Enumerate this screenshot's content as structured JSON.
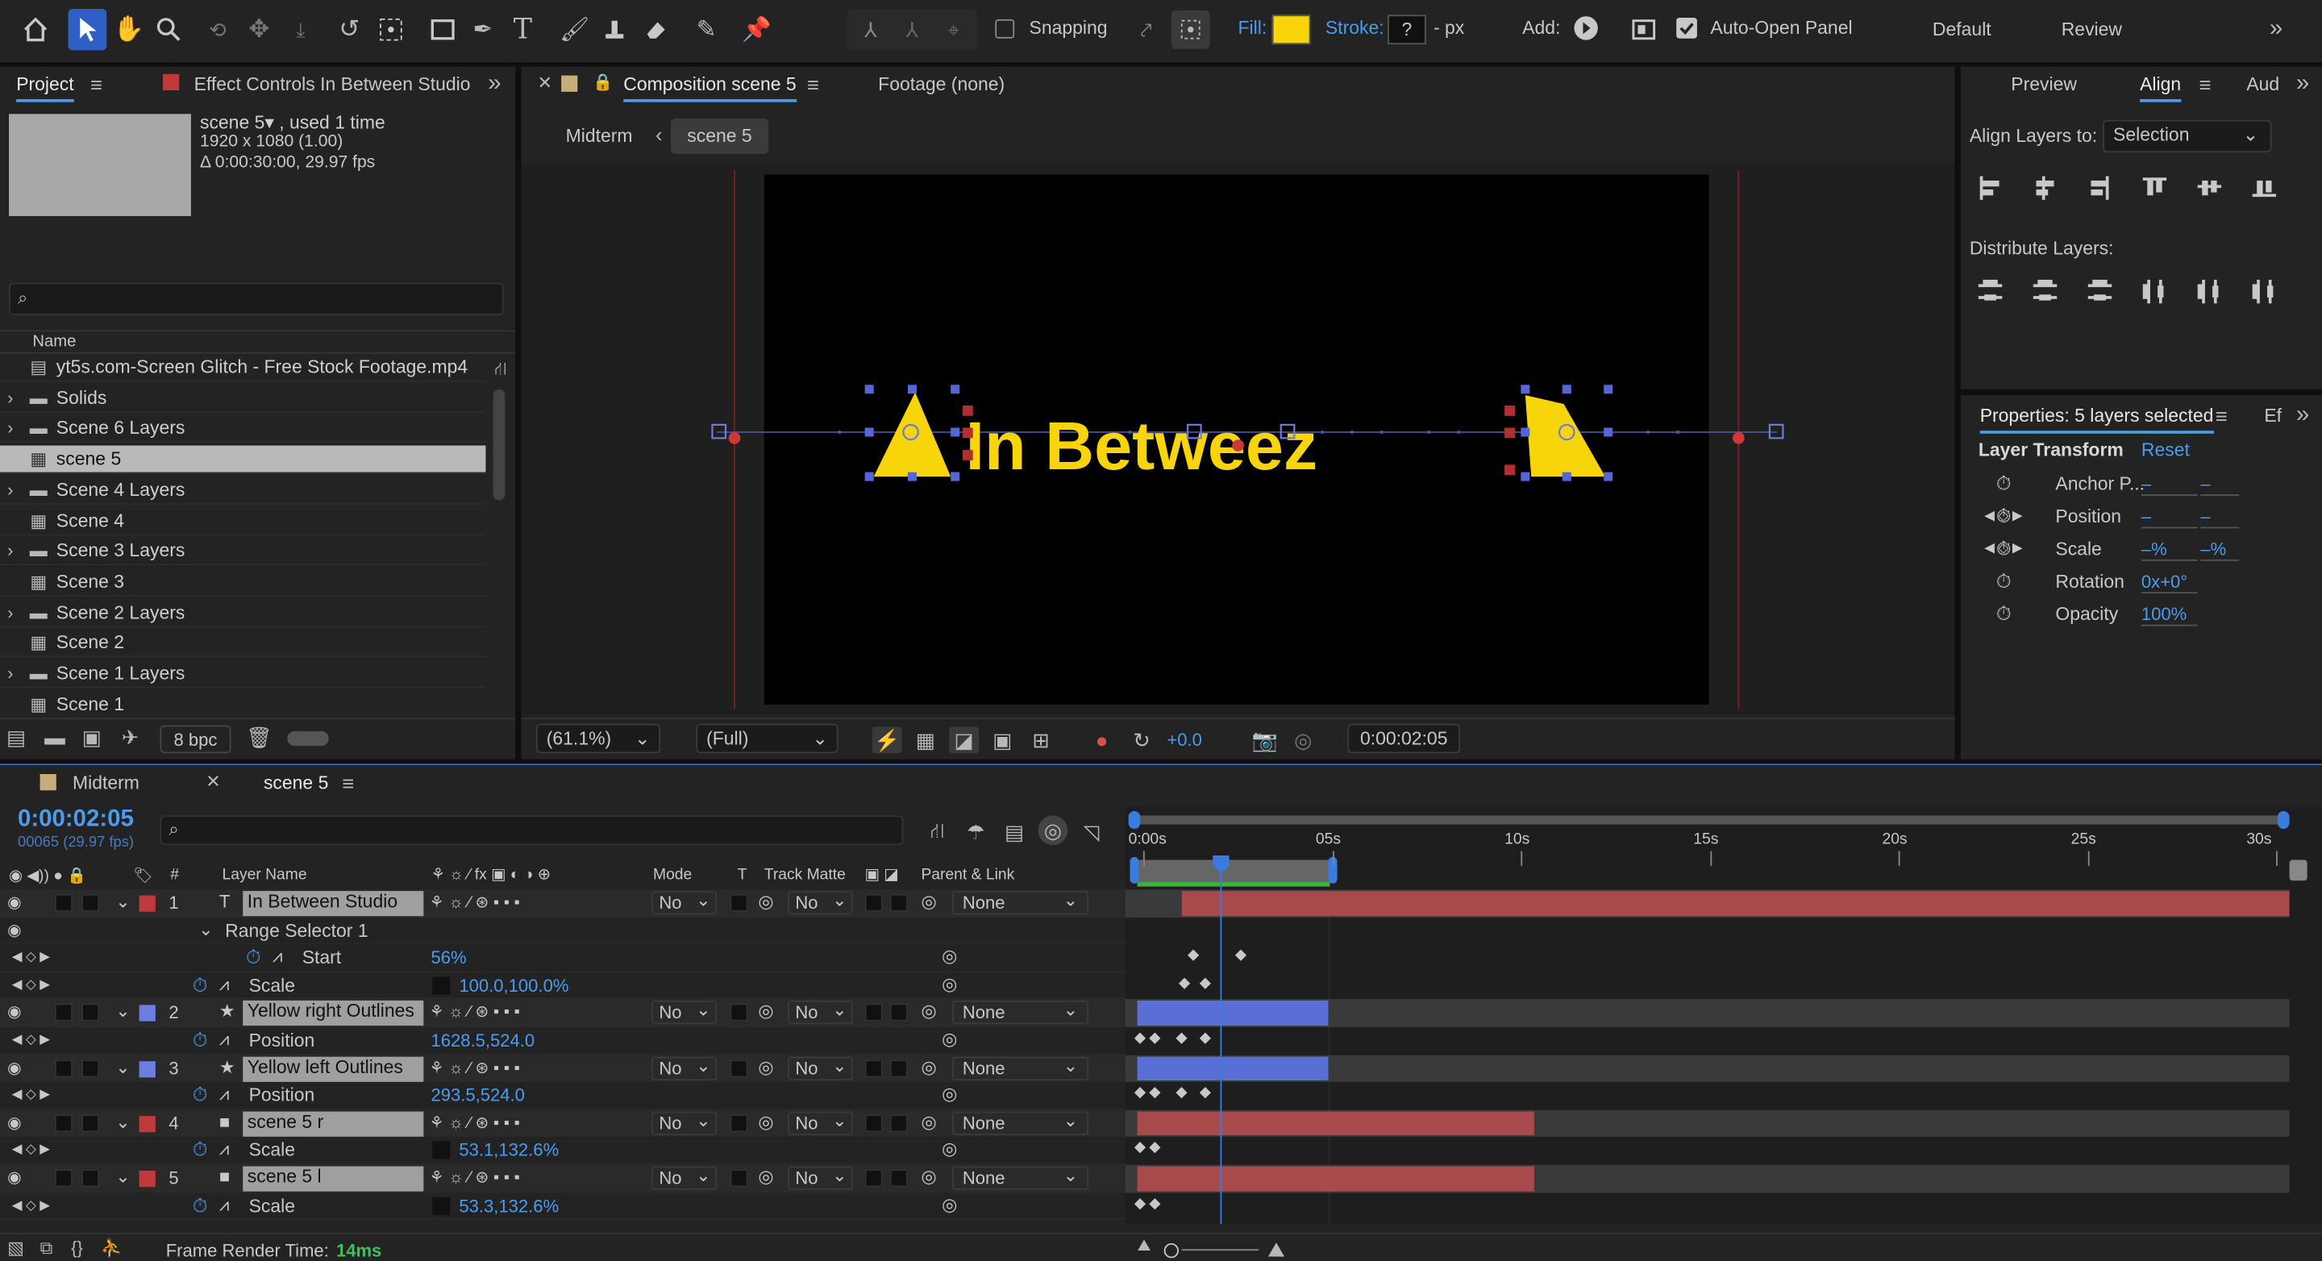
{
  "toolbar": {
    "snapping": "Snapping",
    "fill": "Fill:",
    "stroke": "Stroke:",
    "stroke_val": "?",
    "stroke_unit": "- px",
    "add": "Add:",
    "auto_open": "Auto-Open Panel",
    "workspace_default": "Default",
    "workspace_review": "Review",
    "fill_color": "#f8d40a"
  },
  "project": {
    "tab": "Project",
    "effect_tab": "Effect Controls In Between Studio",
    "item_name": "scene 5▾ , used 1 time",
    "item_res": "1920 x 1080 (1.00)",
    "item_dur": "Δ 0:00:30:00, 29.97 fps",
    "col_name": "Name",
    "bpc": "8 bpc",
    "items": [
      {
        "label": "yt5s.com-Screen Glitch - Free Stock Footage.mp4",
        "kind": "file"
      },
      {
        "label": "Solids",
        "kind": "folder"
      },
      {
        "label": "Scene 6 Layers",
        "kind": "folder"
      },
      {
        "label": "scene 5",
        "kind": "comp"
      },
      {
        "label": "Scene 4 Layers",
        "kind": "folder"
      },
      {
        "label": "Scene 4",
        "kind": "comp"
      },
      {
        "label": "Scene 3 Layers",
        "kind": "folder"
      },
      {
        "label": "Scene 3",
        "kind": "comp"
      },
      {
        "label": "Scene 2 Layers",
        "kind": "folder"
      },
      {
        "label": "Scene 2",
        "kind": "comp"
      },
      {
        "label": "Scene 1 Layers",
        "kind": "folder"
      },
      {
        "label": "Scene 1",
        "kind": "comp"
      }
    ]
  },
  "comp": {
    "tab": "Composition scene 5",
    "footage": "Footage (none)",
    "crumb_parent": "Midterm",
    "crumb_current": "scene 5",
    "title_text": "In Betweez",
    "zoom": "(61.1%)",
    "quality": "(Full)",
    "exposure": "+0.0",
    "timecode": "0:00:02:05"
  },
  "right": {
    "tab_preview": "Preview",
    "tab_align": "Align",
    "tab_audio": "Aud",
    "align_to_label": "Align Layers to:",
    "align_to_value": "Selection",
    "distribute": "Distribute Layers:",
    "props_title": "Properties: 5 layers selected",
    "props_tab2": "Ef",
    "layer_transform": "Layer Transform",
    "reset": "Reset",
    "props": [
      {
        "label": "Anchor P...",
        "v1": "–",
        "v2": "–"
      },
      {
        "label": "Position",
        "v1": "–",
        "v2": "–"
      },
      {
        "label": "Scale",
        "v1": "–%",
        "v2": "–%"
      },
      {
        "label": "Rotation",
        "v1": "0x+0°",
        "v2": ""
      },
      {
        "label": "Opacity",
        "v1": "100%",
        "v2": ""
      }
    ]
  },
  "timeline": {
    "tab_midterm": "Midterm",
    "tab_scene": "scene 5",
    "timecode": "0:00:02:05",
    "frames": "00065 (29.97 fps)",
    "headers": {
      "layer_name": "Layer Name",
      "mode": "Mode",
      "t": "T",
      "track_matte": "Track Matte",
      "parent": "Parent & Link"
    },
    "ruler": [
      "0:00s",
      "05s",
      "10s",
      "15s",
      "20s",
      "25s",
      "30s"
    ],
    "rows": [
      {
        "type": "layer",
        "num": "1",
        "name": "In Between Studio",
        "icon": "T",
        "color": "#c0393b",
        "mode": "No",
        "matte": "No",
        "parent": "None"
      },
      {
        "type": "group",
        "name": "Range Selector 1"
      },
      {
        "type": "prop",
        "name": "Start",
        "value": "56%"
      },
      {
        "type": "prop",
        "name": "Scale",
        "value": "100.0,100.0%"
      },
      {
        "type": "layer",
        "num": "2",
        "name": "Yellow right Outlines",
        "icon": "★",
        "color": "#6a7fe0",
        "mode": "No",
        "matte": "No",
        "parent": "None"
      },
      {
        "type": "prop",
        "name": "Position",
        "value": "1628.5,524.0"
      },
      {
        "type": "layer",
        "num": "3",
        "name": "Yellow left Outlines",
        "icon": "★",
        "color": "#6a7fe0",
        "mode": "No",
        "matte": "No",
        "parent": "None"
      },
      {
        "type": "prop",
        "name": "Position",
        "value": "293.5,524.0"
      },
      {
        "type": "layer",
        "num": "4",
        "name": "scene 5 r",
        "icon": "■",
        "color": "#c0393b",
        "mode": "No",
        "matte": "No",
        "parent": "None"
      },
      {
        "type": "prop",
        "name": "Scale",
        "value": "53.1,132.6%"
      },
      {
        "type": "layer",
        "num": "5",
        "name": "scene 5 l",
        "icon": "■",
        "color": "#c0393b",
        "mode": "No",
        "matte": "No",
        "parent": "None"
      },
      {
        "type": "prop",
        "name": "Scale",
        "value": "53.3,132.6%"
      }
    ],
    "frame_render_label": "Frame Render Time:",
    "frame_render_value": "14ms"
  }
}
